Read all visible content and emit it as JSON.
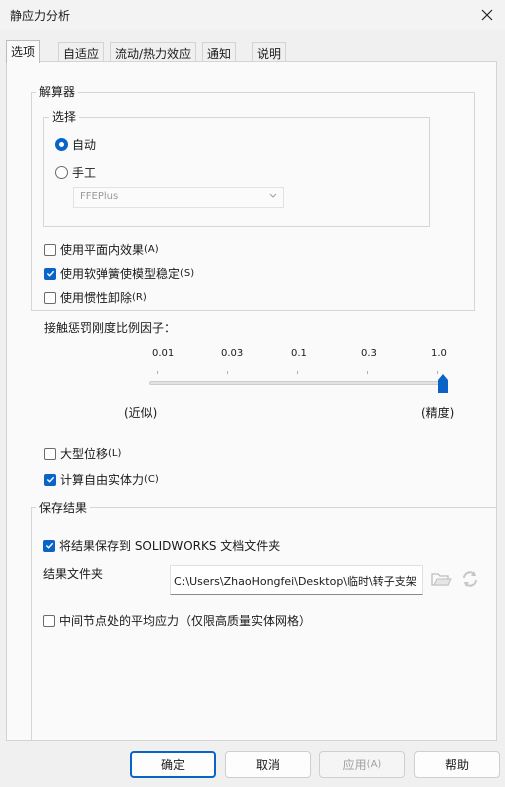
{
  "window": {
    "title": "静应力分析"
  },
  "tabs": [
    {
      "label": "选项"
    },
    {
      "label": "自适应"
    },
    {
      "label": "流动/热力效应"
    },
    {
      "label": "通知"
    },
    {
      "label": "说明"
    }
  ],
  "solver": {
    "group_label": "解算器",
    "selection_label": "选择",
    "auto_label": "自动",
    "manual_label": "手工",
    "solver_value": "FFEPlus",
    "selected": "auto"
  },
  "options": {
    "inplane_label": "使用平面内效果",
    "inplane_shortcut": "(A)",
    "inplane_checked": false,
    "soft_spring_label": "使用软弹簧使模型稳定",
    "soft_spring_shortcut": "(S)",
    "soft_spring_checked": true,
    "inertial_label": "使用惯性卸除",
    "inertial_shortcut": "(R)",
    "inertial_checked": false
  },
  "contact": {
    "label": "接触惩罚刚度比例因子：",
    "ticks": [
      "0.01",
      "0.03",
      "0.1",
      "0.3",
      "1.0"
    ],
    "left_label": "(近似)",
    "right_label": "(精度)",
    "value": 1.0
  },
  "large_disp": {
    "label": "大型位移",
    "shortcut": "(L)",
    "checked": false
  },
  "free_body": {
    "label": "计算自由实体力",
    "shortcut": "(C)",
    "checked": true
  },
  "save": {
    "group_label": "保存结果",
    "save_to_docs_label": "将结果保存到 SOLIDWORKS 文档文件夹",
    "save_to_docs_checked": true,
    "folder_label": "结果文件夹",
    "folder_value": "C:\\Users\\ZhaoHongfei\\Desktop\\临时\\转子支架"
  },
  "avg_stress": {
    "label": "中间节点处的平均应力（仅限高质量实体网格）",
    "checked": false
  },
  "buttons": {
    "ok": "确定",
    "cancel": "取消",
    "apply": "应用",
    "apply_shortcut": "(A)",
    "help": "帮助"
  },
  "colors": {
    "accent": "#0a64c8"
  }
}
